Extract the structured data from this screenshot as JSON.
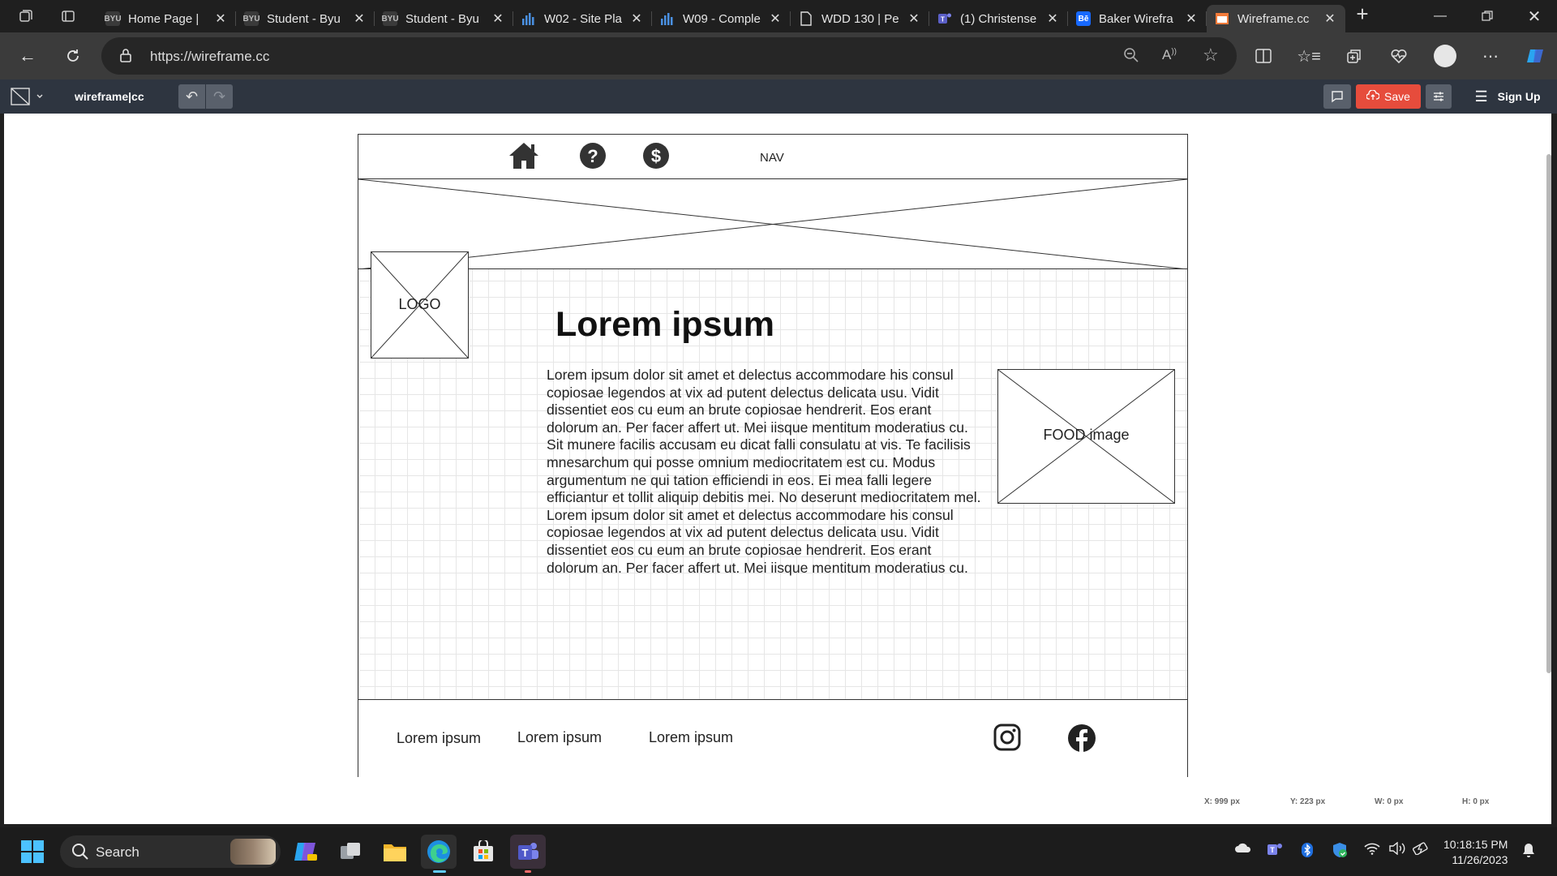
{
  "browser": {
    "tabs": [
      {
        "title": "Home Page |",
        "favicon": "byu-logo-icon"
      },
      {
        "title": "Student - Byu",
        "favicon": "byu-logo-icon"
      },
      {
        "title": "Student - Byu",
        "favicon": "byu-logo-icon"
      },
      {
        "title": "W02 - Site Pla",
        "favicon": "bar-chart-icon"
      },
      {
        "title": "W09 - Comple",
        "favicon": "bar-chart-icon"
      },
      {
        "title": "WDD 130 | Pe",
        "favicon": "document-icon"
      },
      {
        "title": "(1) Christense",
        "favicon": "teams-icon"
      },
      {
        "title": "Baker Wirefra",
        "favicon": "behance-icon"
      },
      {
        "title": "Wireframe.cc",
        "favicon": "wireframe-icon",
        "active": true
      }
    ],
    "favicon_text": {
      "byu": "BYU",
      "behance": "Bē"
    },
    "url": "https://wireframe.cc",
    "colors": {
      "accent": "#2b7cd3",
      "save": "#e64c3c",
      "toolbar": "#2e3540"
    }
  },
  "app": {
    "brand": "wireframe|cc",
    "save_label": "Save",
    "signup_label": "Sign Up"
  },
  "wireframe": {
    "nav_label": "NAV",
    "nav_icons": [
      "home-icon",
      "help-circle-icon",
      "dollar-circle-icon"
    ],
    "logo_label": "LOGO",
    "heading": "Lorem ipsum",
    "paragraph": "Lorem ipsum dolor sit amet et delectus accommodare his consul\ncopiosae legendos at vix ad putent delectus delicata usu. Vidit\ndissentiet eos cu eum an brute copiosae hendrerit. Eos erant\ndolorum an. Per facer affert ut. Mei iisque mentitum moderatius cu.\nSit munere facilis accusam eu dicat falli consulatu at vis. Te facilisis\nmnesarchum qui posse omnium mediocritatem est cu. Modus\nargumentum ne qui tation efficiendi in eos. Ei mea falli legere\nefficiantur et tollit aliquip debitis mei. No deserunt mediocritatem mel.\nLorem ipsum dolor sit amet et delectus accommodare his consul\ncopiosae legendos at vix ad putent delectus delicata usu. Vidit\ndissentiet eos cu eum an brute copiosae hendrerit. Eos erant\ndolorum an. Per facer affert ut. Mei iisque mentitum moderatius cu.",
    "food_label": "FOOD image",
    "footer_links": [
      "Lorem ipsum",
      "Lorem ipsum",
      "Lorem ipsum"
    ],
    "social_icons": [
      "instagram-icon",
      "facebook-icon"
    ]
  },
  "status": {
    "x": "X: 999 px",
    "y": "Y: 223 px",
    "w": "W: 0 px",
    "h": "H: 0 px"
  },
  "taskbar": {
    "search_label": "Search",
    "time": "10:18:15 PM",
    "date": "11/26/2023"
  }
}
